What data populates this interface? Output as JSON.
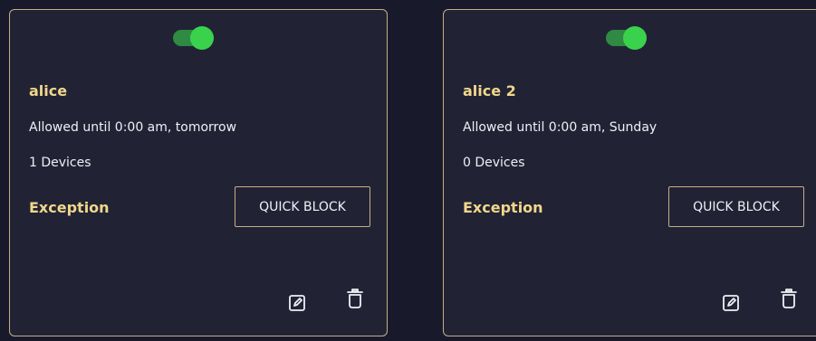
{
  "colors": {
    "background": "#181a2c",
    "card": "#212335",
    "card_border": "#c5ae86",
    "accent_text": "#f1d78b",
    "body_text": "#eef0f5",
    "toggle_on": "#3ad24d"
  },
  "cards": [
    {
      "name": "alice",
      "toggle_on": true,
      "allowed": "Allowed until 0:00 am, tomorrow",
      "devices": "1 Devices",
      "exception_label": "Exception",
      "quick_block_label": "QUICK BLOCK",
      "edit_icon": "edit-icon",
      "delete_icon": "trash-icon"
    },
    {
      "name": "alice 2",
      "toggle_on": true,
      "allowed": "Allowed until 0:00 am, Sunday",
      "devices": "0 Devices",
      "exception_label": "Exception",
      "quick_block_label": "QUICK BLOCK",
      "edit_icon": "edit-icon",
      "delete_icon": "trash-icon"
    }
  ]
}
